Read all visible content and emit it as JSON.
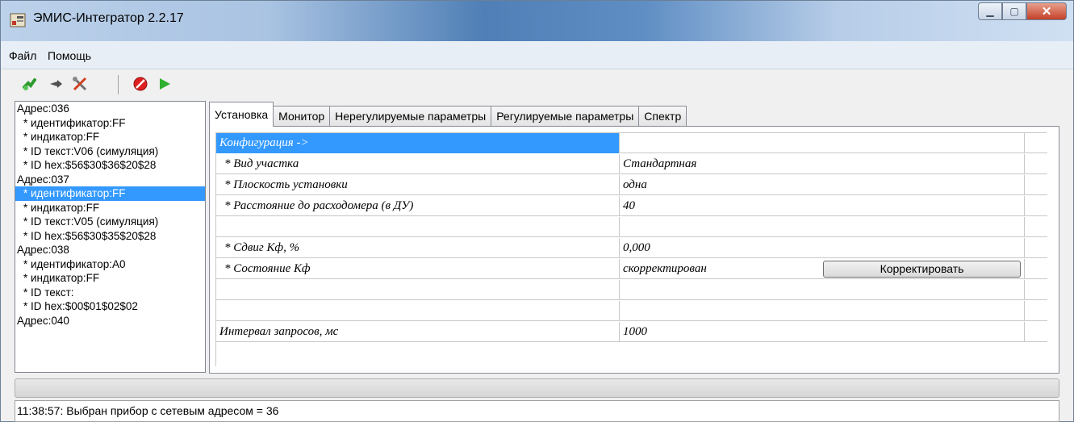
{
  "window": {
    "title": "ЭМИС-Интегратор 2.2.17"
  },
  "menu": {
    "items": [
      "Файл",
      "Помощь"
    ]
  },
  "toolbar": {
    "icons": [
      "connect-icon",
      "arrow-icon",
      "tools-icon",
      "stop-icon",
      "play-icon"
    ]
  },
  "tree": {
    "rows": [
      {
        "text": "Адрес:036",
        "level": "root"
      },
      {
        "text": "* идентификатор:FF",
        "level": "child"
      },
      {
        "text": "* индикатор:FF",
        "level": "child"
      },
      {
        "text": "* ID текст:V06 (симуляция)",
        "level": "child"
      },
      {
        "text": "* ID hex:$56$30$36$20$28",
        "level": "child"
      },
      {
        "text": "Адрес:037",
        "level": "root"
      },
      {
        "text": "* идентификатор:FF",
        "level": "child",
        "selected": true
      },
      {
        "text": "* индикатор:FF",
        "level": "child"
      },
      {
        "text": "* ID текст:V05 (симуляция)",
        "level": "child"
      },
      {
        "text": "* ID hex:$56$30$35$20$28",
        "level": "child"
      },
      {
        "text": "Адрес:038",
        "level": "root"
      },
      {
        "text": "* идентификатор:A0",
        "level": "child"
      },
      {
        "text": "* индикатор:FF",
        "level": "child"
      },
      {
        "text": "* ID текст:",
        "level": "child"
      },
      {
        "text": "* ID hex:$00$01$02$02",
        "level": "child"
      },
      {
        "text": "Адрес:040",
        "level": "root"
      }
    ]
  },
  "tabs": {
    "items": [
      "Установка",
      "Монитор",
      "Нерегулируемые параметры",
      "Регулируемые параметры",
      "Спектр"
    ],
    "active": 0
  },
  "setup": {
    "rows": [
      {
        "name": "Конфигурация ->",
        "value": "",
        "header": true
      },
      {
        "name": "* Вид участка",
        "value": "Стандартная"
      },
      {
        "name": "* Плоскость установки",
        "value": "одна"
      },
      {
        "name": "* Расстояние до расходомера (в ДУ)",
        "value": "40"
      },
      {
        "name": "",
        "value": ""
      },
      {
        "name": "* Сдвиг Кф, %",
        "value": "0,000"
      },
      {
        "name": "* Состояние Кф",
        "value": "скорректирован",
        "button": "Корректировать"
      },
      {
        "name": "",
        "value": ""
      },
      {
        "name": "",
        "value": ""
      },
      {
        "name": "Интервал запросов, мс",
        "value": "1000"
      }
    ]
  },
  "progress": {
    "value": 0
  },
  "status": {
    "text": "11:38:57: Выбран прибор с сетевым адресом = 36"
  }
}
